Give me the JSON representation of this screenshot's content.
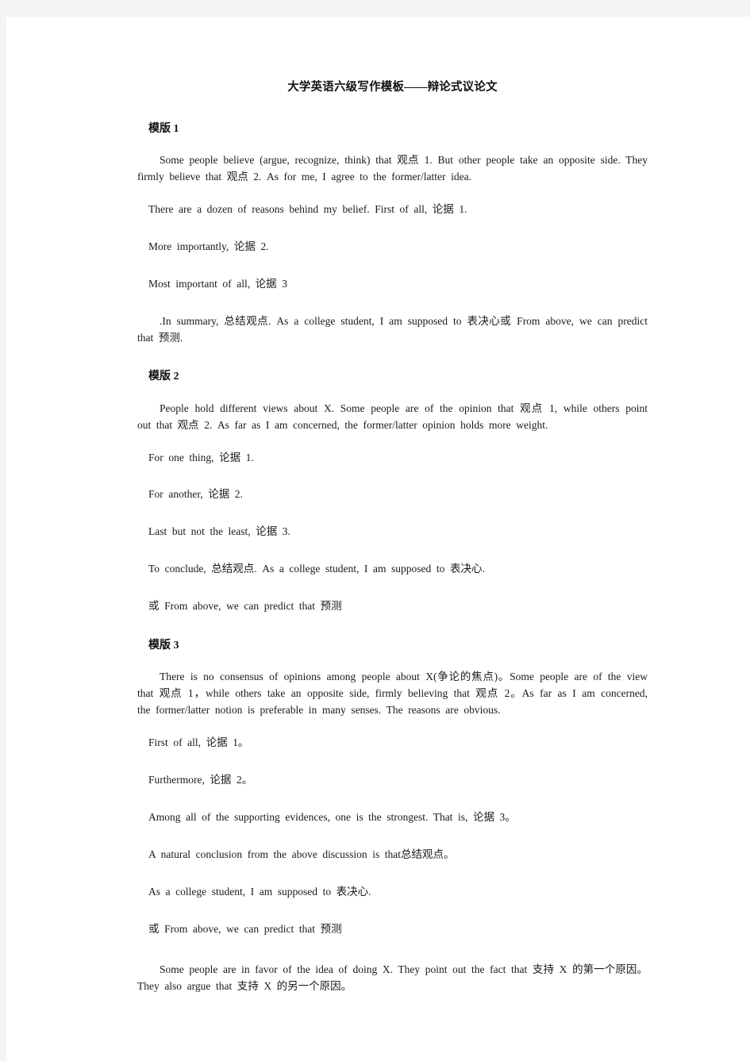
{
  "document": {
    "title": "大学英语六级写作模板——辩论式议论文",
    "page_background": "#ffffff",
    "canvas_background": "#f4f4f4",
    "text_color": "#1a1a1a"
  },
  "sections": [
    {
      "heading": "模版 1",
      "paragraphs": [
        "Some people believe (argue, recognize, think) that 观点 1. But other people take an opposite side. They firmly believe that 观点 2. As for me, I agree to the former/latter idea.",
        "There are a dozen of reasons behind my belief. First of all, 论据 1.",
        "More importantly, 论据 2.",
        "Most important of all, 论据 3",
        ".In summary, 总结观点. As a college student, I am supposed to 表决心或 From above, we can predict that 预测."
      ]
    },
    {
      "heading": "模版 2",
      "paragraphs": [
        "People hold different views about X. Some people are of the opinion that 观点 1, while others point out that 观点 2. As far as I am concerned, the former/latter opinion holds more weight.",
        "For one thing, 论据 1.",
        "For another, 论据 2.",
        "Last but not the least, 论据 3.",
        "To conclude, 总结观点. As a college student, I am supposed to 表决心.",
        "或 From above, we can predict that 预测"
      ]
    },
    {
      "heading": "模版 3",
      "paragraphs": [
        "There is no consensus of opinions among people about X(争论的焦点)。Some people are of the view that 观点 1，while others take an opposite side, firmly believing that 观点 2。As far as I am concerned, the former/latter notion is preferable in many senses. The reasons are obvious.",
        "First of all, 论据 1。",
        "Furthermore, 论据 2。",
        "Among all of the supporting evidences, one is the strongest. That is, 论据 3。",
        "A natural conclusion from the above discussion is that总结观点。",
        "As a college student, I am supposed to 表决心.",
        "或 From above, we can predict that 预测",
        "Some people are in favor of the idea of doing X. They point out the fact that 支持 X 的第一个原因。They also argue that 支持 X 的另一个原因。"
      ]
    }
  ]
}
